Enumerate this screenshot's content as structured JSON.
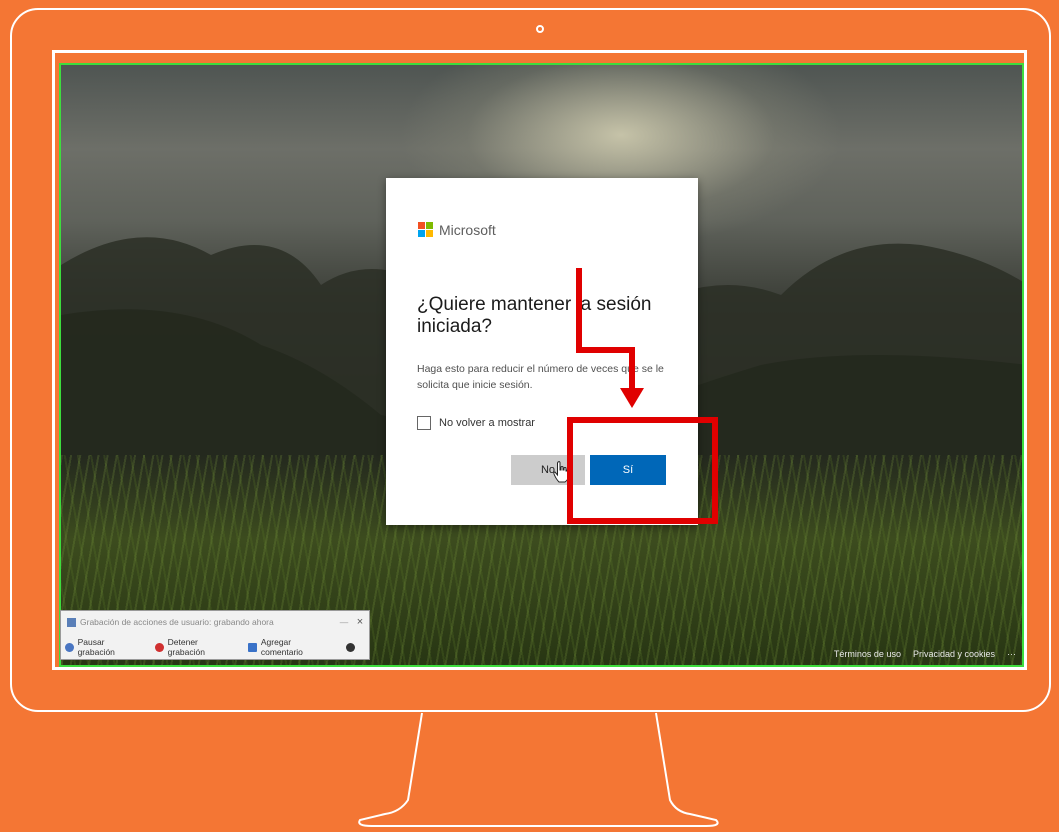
{
  "dialog": {
    "brand": "Microsoft",
    "title": "¿Quiere mantener la sesión iniciada?",
    "description": "Haga esto para reducir el número de veces que se le solicita que inicie sesión.",
    "checkbox_label": "No volver a mostrar",
    "no_label": "No",
    "yes_label": "Sí"
  },
  "recorder": {
    "title": "Grabación de acciones de usuario: grabando ahora",
    "pause_label": "Pausar grabación",
    "stop_label": "Detener grabación",
    "comment_label": "Agregar comentario",
    "close_icon": "×",
    "minimize_icon": "—"
  },
  "footer": {
    "terms": "Términos de uso",
    "privacy": "Privacidad y cookies",
    "more": "···"
  },
  "colors": {
    "background": "#F47634",
    "primary_button": "#0067b8",
    "annotation": "#e00000",
    "screen_border": "#3ddc3d"
  },
  "icons": [
    "microsoft-logo-icon",
    "checkbox-icon",
    "hand-cursor-icon",
    "close-icon",
    "pause-icon",
    "stop-icon",
    "comment-icon",
    "help-icon"
  ]
}
